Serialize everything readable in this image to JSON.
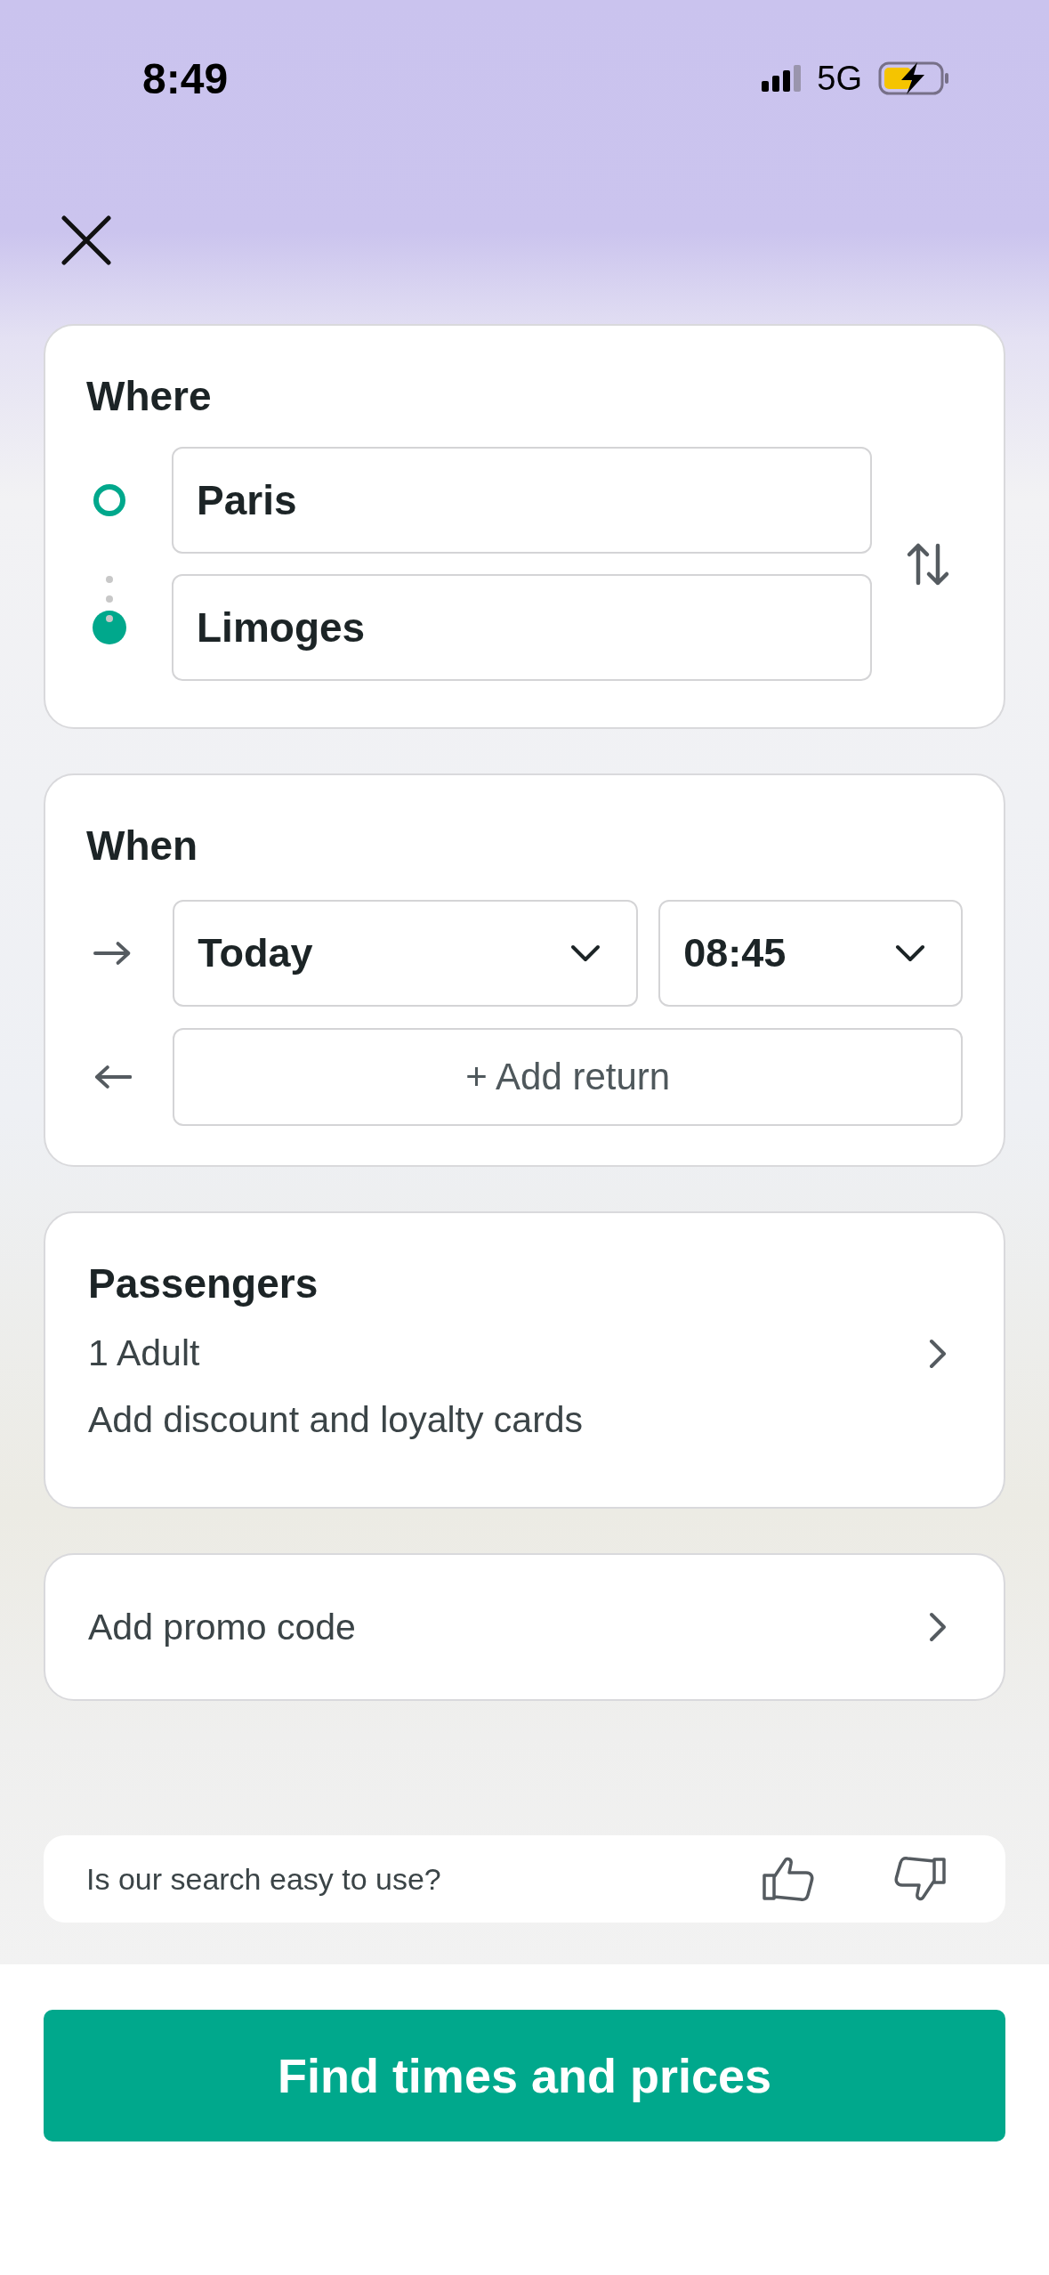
{
  "status_bar": {
    "time": "8:49",
    "network": "5G"
  },
  "where": {
    "title": "Where",
    "stops": [
      {
        "kind": "origin",
        "value": "Paris"
      },
      {
        "kind": "destination",
        "value": "Limoges"
      }
    ]
  },
  "when": {
    "title": "When",
    "date": "Today",
    "time": "08:45",
    "return_label": "+ Add return"
  },
  "passengers": {
    "title": "Passengers",
    "count": "1 Adult",
    "cards_link": "Add discount and loyalty cards"
  },
  "promo": {
    "label": "Add promo code"
  },
  "feedback": {
    "question": "Is our search easy to use?"
  },
  "submit_button": "Find times and prices"
}
